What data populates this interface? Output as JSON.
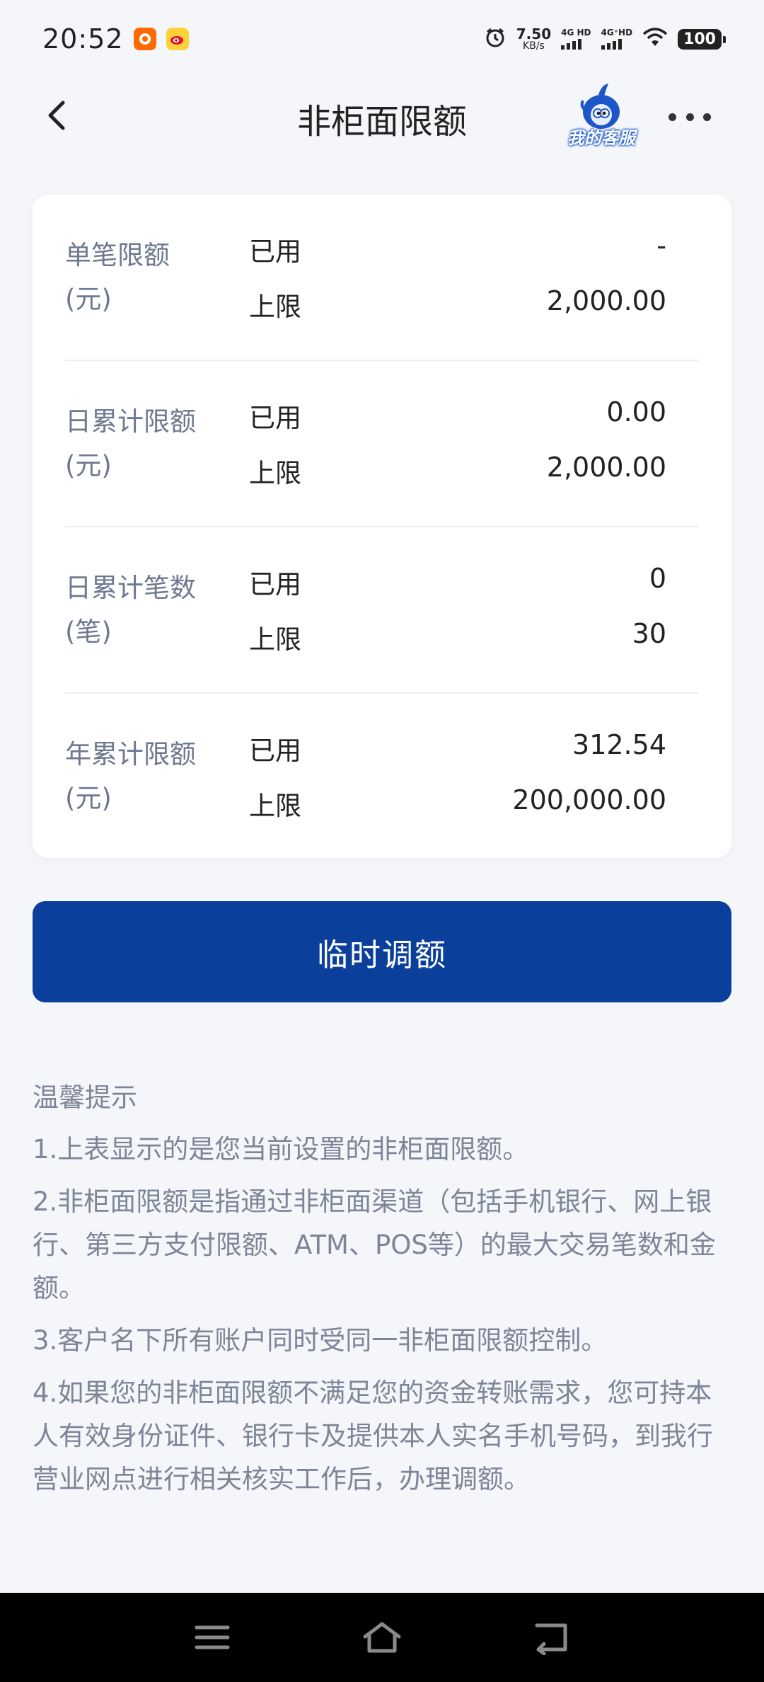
{
  "status_bar": {
    "time": "20:52",
    "speed_value": "7.50",
    "speed_unit": "KB/s",
    "network_1": "4G HD",
    "network_2": "4G⁺HD",
    "battery": "100",
    "icons": [
      "taobao-app-icon",
      "weibo-app-icon",
      "alarm-icon",
      "signal-icon",
      "wifi-icon",
      "battery-icon"
    ]
  },
  "header": {
    "title": "非柜面限额",
    "service_label": "我的客服"
  },
  "limits": [
    {
      "label": "单笔限额(元)",
      "used_label": "已用",
      "used_value": "-",
      "cap_label": "上限",
      "cap_value": "2,000.00"
    },
    {
      "label": "日累计限额(元)",
      "used_label": "已用",
      "used_value": "0.00",
      "cap_label": "上限",
      "cap_value": "2,000.00"
    },
    {
      "label": "日累计笔数(笔)",
      "used_label": "已用",
      "used_value": "0",
      "cap_label": "上限",
      "cap_value": "30"
    },
    {
      "label": "年累计限额(元)",
      "used_label": "已用",
      "used_value": "312.54",
      "cap_label": "上限",
      "cap_value": "200,000.00"
    }
  ],
  "adjust_button": "临时调额",
  "tips": {
    "title": "温馨提示",
    "items": [
      "1.上表显示的是您当前设置的非柜面限额。",
      "2.非柜面限额是指通过非柜面渠道（包括手机银行、网上银行、第三方支付限额、ATM、POS等）的最大交易笔数和金额。",
      "3.客户名下所有账户同时受同一非柜面限额控制。",
      "4.如果您的非柜面限额不满足您的资金转账需求，您可持本人有效身份证件、银行卡及提供本人实名手机号码，到我行营业网点进行相关核实工作后，办理调额。"
    ]
  },
  "colors": {
    "primary": "#0a3f9c",
    "background": "#f5f6fa",
    "label_gray": "#6e7890",
    "tip_gray": "#7d8598"
  }
}
